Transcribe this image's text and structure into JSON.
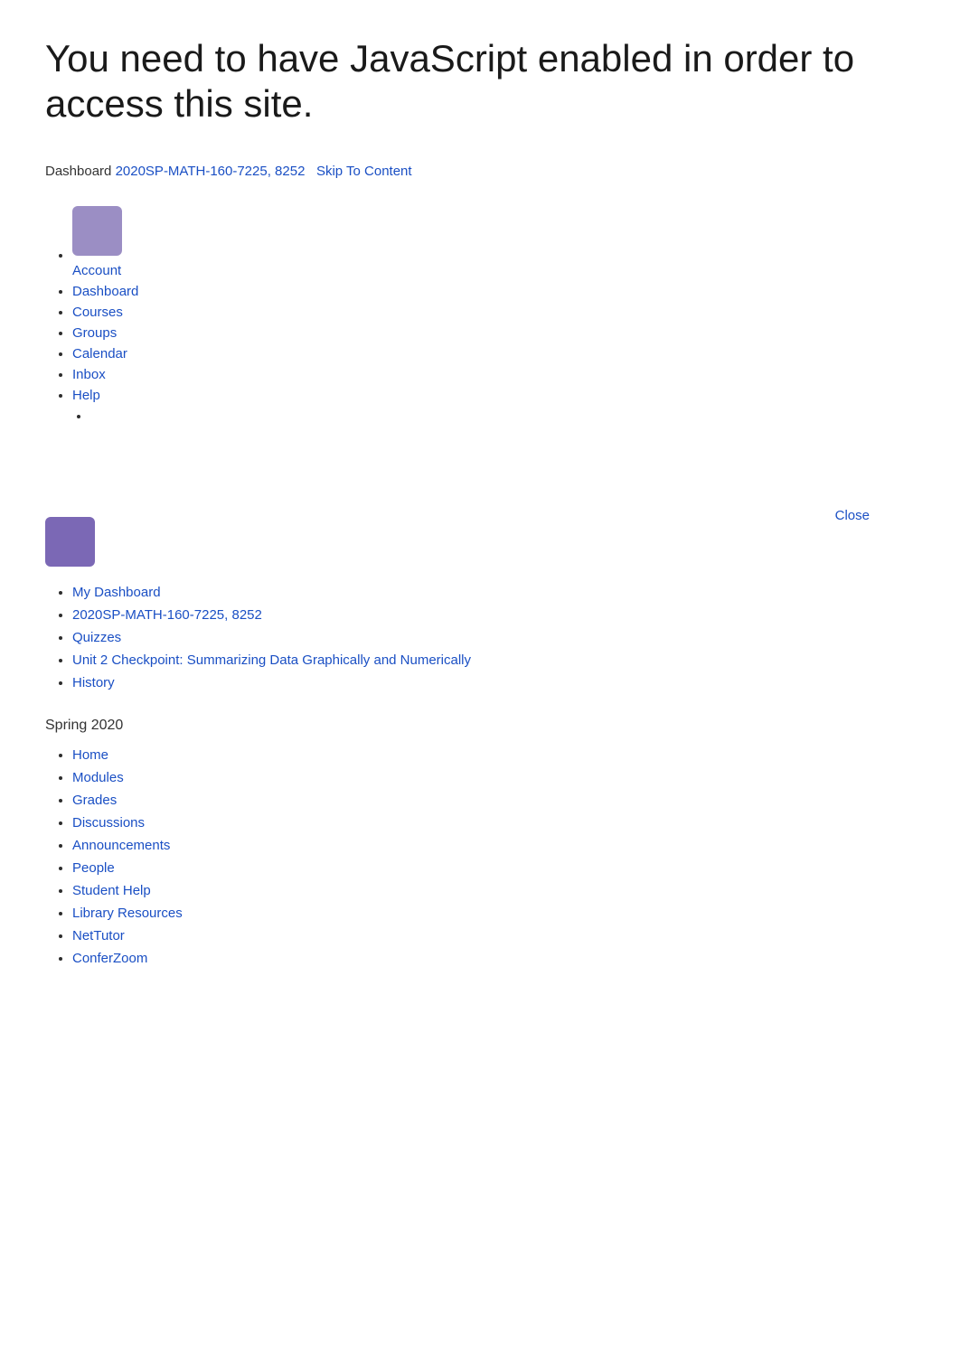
{
  "warning": {
    "heading": "You need to have JavaScript enabled in order to access this site."
  },
  "breadcrumb": {
    "prefix": "Dashboard",
    "course_link": "2020SP-MATH-160-7225, 8252",
    "skip_link": "Skip To Content"
  },
  "global_nav": {
    "avatar_alt": "user avatar",
    "items": [
      {
        "label": "Account",
        "href": "#"
      },
      {
        "label": "Dashboard",
        "href": "#"
      },
      {
        "label": "Courses",
        "href": "#"
      },
      {
        "label": "Groups",
        "href": "#"
      },
      {
        "label": "Calendar",
        "href": "#"
      },
      {
        "label": "Inbox",
        "href": "#"
      },
      {
        "label": "Help",
        "href": "#"
      }
    ]
  },
  "panel": {
    "close_label": "Close",
    "breadcrumbs": [
      {
        "label": "My Dashboard",
        "href": "#"
      },
      {
        "label": "2020SP-MATH-160-7225, 8252",
        "href": "#"
      },
      {
        "label": "Quizzes",
        "href": "#"
      },
      {
        "label": "Unit 2 Checkpoint: Summarizing Data Graphically and Numerically",
        "href": "#"
      },
      {
        "label": "History",
        "href": "#"
      }
    ]
  },
  "course_section": {
    "semester": "Spring 2020",
    "nav_items": [
      {
        "label": "Home",
        "href": "#"
      },
      {
        "label": "Modules",
        "href": "#"
      },
      {
        "label": "Grades",
        "href": "#"
      },
      {
        "label": "Discussions",
        "href": "#"
      },
      {
        "label": "Announcements",
        "href": "#"
      },
      {
        "label": "People",
        "href": "#"
      },
      {
        "label": "Student Help",
        "href": "#"
      },
      {
        "label": "Library Resources",
        "href": "#"
      },
      {
        "label": "NetTutor",
        "href": "#"
      },
      {
        "label": "ConferZoom",
        "href": "#"
      }
    ]
  }
}
